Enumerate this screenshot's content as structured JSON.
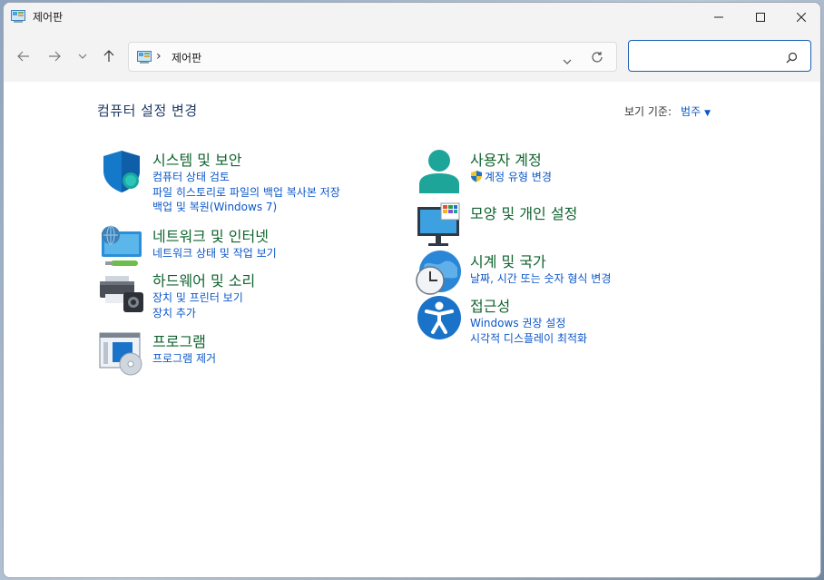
{
  "window": {
    "title": "제어판"
  },
  "address": {
    "breadcrumb": "제어판",
    "separator": "›",
    "search_placeholder": ""
  },
  "main": {
    "heading": "컴퓨터 설정 변경",
    "view_by_label": "보기 기준:",
    "view_by_value": "범주"
  },
  "categories": {
    "system": {
      "title": "시스템 및 보안",
      "links": [
        "컴퓨터 상태 검토",
        "파일 히스토리로 파일의 백업 복사본 저장",
        "백업 및 복원(Windows 7)"
      ]
    },
    "network": {
      "title": "네트워크 및 인터넷",
      "links": [
        "네트워크 상태 및 작업 보기"
      ]
    },
    "hardware": {
      "title": "하드웨어 및 소리",
      "links": [
        "장치 및 프린터 보기",
        "장치 추가"
      ]
    },
    "programs": {
      "title": "프로그램",
      "links": [
        "프로그램 제거"
      ]
    },
    "users": {
      "title": "사용자 계정",
      "links": [
        "계정 유형 변경"
      ]
    },
    "appearance": {
      "title": "모양 및 개인 설정",
      "links": []
    },
    "clock": {
      "title": "시계 및 국가",
      "links": [
        "날짜, 시간 또는 숫자 형식 변경"
      ]
    },
    "access": {
      "title": "접근성",
      "links": [
        "Windows 권장 설정",
        "시각적 디스플레이 최적화"
      ]
    }
  },
  "colors": {
    "category_title": "#10642f",
    "link": "#0b57c9",
    "heading": "#1e3a64"
  },
  "icons": {
    "back": "arrow-left-icon",
    "forward": "arrow-right-icon",
    "recent": "chevron-down-icon",
    "up": "arrow-up-icon",
    "refresh": "refresh-icon",
    "search": "search-icon"
  }
}
